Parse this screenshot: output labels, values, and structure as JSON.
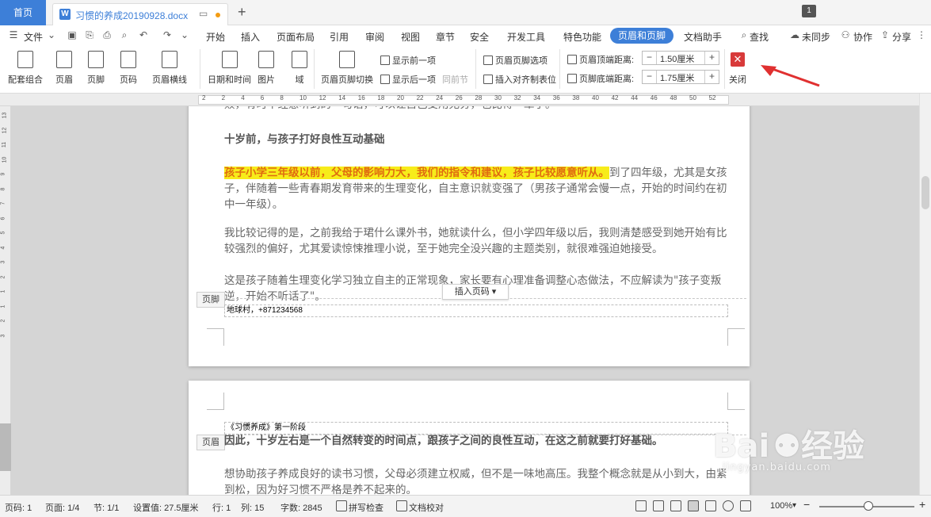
{
  "tabs": {
    "home_label": "首页",
    "doc_icon": "W",
    "doc_name": "习惯的养成20190928.docx",
    "add_label": "+",
    "win_badge": "1"
  },
  "menu": {
    "file": "文件",
    "items": [
      "开始",
      "插入",
      "页面布局",
      "引用",
      "审阅",
      "视图",
      "章节",
      "安全",
      "开发工具",
      "特色功能",
      "页眉和页脚",
      "文档助手"
    ],
    "active": "页眉和页脚",
    "search": "查找",
    "sync": "未同步",
    "collab": "协作",
    "share": "分享"
  },
  "ribbon": {
    "preset": "配套组合",
    "header": "页眉",
    "footer": "页脚",
    "page_no": "页码",
    "header_line": "页眉横线",
    "datetime": "日期和时间",
    "picture": "图片",
    "field": "域",
    "switch": "页眉页脚切换",
    "show_prev": "显示前一项",
    "show_next": "显示后一项",
    "same_prev": "同前节",
    "options": "页眉页脚选项",
    "insert_align_tab": "插入对齐制表位",
    "header_top_label": "页眉顶端距离:",
    "header_top_value": "1.50厘米",
    "footer_bottom_label": "页脚底端距离:",
    "footer_bottom_value": "1.75厘米",
    "close": "关闭"
  },
  "ruler": {
    "ticks": [
      "2",
      "2",
      "4",
      "6",
      "8",
      "10",
      "12",
      "14",
      "16",
      "18",
      "20",
      "22",
      "24",
      "26",
      "28",
      "30",
      "32",
      "34",
      "36",
      "38",
      "40",
      "42",
      "44",
      "46",
      "48",
      "50",
      "52"
    ],
    "vticks": [
      "13",
      "12",
      "11",
      "10",
      "9",
      "8",
      "7",
      "6",
      "5",
      "4",
      "3",
      "2",
      "1",
      "1",
      "2",
      "3"
    ]
  },
  "doc": {
    "line0": "败，有时不经意听到的一句话，可以让自己受用无穷，也比得一辈子。",
    "heading": "十岁前，与孩子打好良性互动基础",
    "p1_highlight": "孩子小学三年级以前，父母的影响力大，我们的指令和建议，孩子比较愿意听从。",
    "p1_rest": "到了四年级，尤其是女孩子，伴随着一些青春期发育带来的生理变化，自主意识就变强了（男孩子通常会慢一点，开始的时间约在初中一年级）。",
    "p2": "我比较记得的是，之前我给于珺什么课外书，她就读什么，但小学四年级以后，我则清楚感受到她开始有比较强烈的偏好，尤其爱读惊悚推理小说，至于她完全没兴趣的主题类别，就很难强迫她接受。",
    "p3": "这是孩子随着生理变化学习独立自主的正常现象，家长要有心理准备调整心态做法，不应解读为\"孩子变叛逆，开始不听话了\"。",
    "footer_tag": "页脚",
    "footer_text": "地球村，+871234568",
    "insert_pageno": "插入页码",
    "header_tag": "页眉",
    "header_text": "《习惯养成》第一阶段",
    "p4": "因此，十岁左右是一个自然转变的时间点，跟孩子之间的良性互动，在这之前就要打好基础。",
    "p5": "想协助孩子养成良好的读书习惯，父母必须建立权威，但不是一味地高压。我整个概念就是从小到大，由紧到松，因为好习惯不严格是养不起来的。"
  },
  "status": {
    "page": "页码: 1",
    "pages": "页面: 1/4",
    "section": "节: 1/1",
    "setting": "设置值: 27.5厘米",
    "row": "行: 1",
    "col": "列: 15",
    "words": "字数: 2845",
    "spell": "拼写检查",
    "proof": "文档校对",
    "zoom": "100%"
  },
  "watermark": {
    "brand": "Bai",
    "brand2": "经验",
    "site": "jingyan.baidu.com"
  },
  "colors": {
    "accent": "#3d7fd8",
    "close": "#d83a3a",
    "highlight_bg": "#f7ec1a",
    "highlight_fg": "#e06b10",
    "arrow": "#e03030"
  }
}
